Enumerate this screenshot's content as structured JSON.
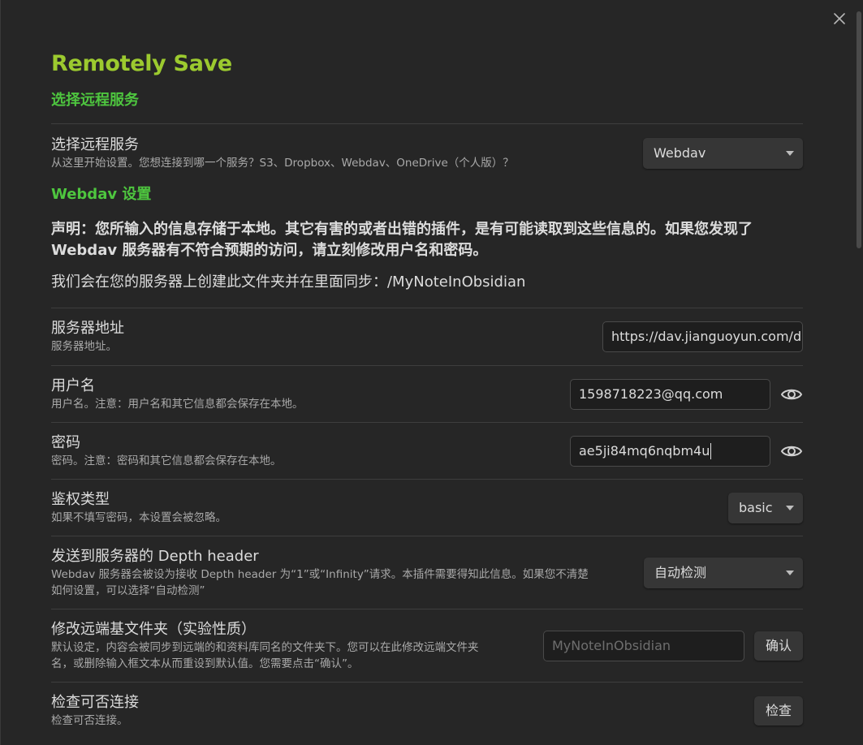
{
  "modal": {
    "title": "Remotely Save",
    "close_icon": "close-icon"
  },
  "section_remote": {
    "heading": "选择远程服务"
  },
  "choose_service": {
    "name": "选择远程服务",
    "desc": "从这里开始设置。您想连接到哪一个服务？S3、Dropbox、Webdav、OneDrive（个人版）？",
    "value": "Webdav"
  },
  "section_webdav": {
    "heading": "Webdav 设置"
  },
  "notice": {
    "line1": "声明：您所输入的信息存储于本地。其它有害的或者出错的插件，是有可能读取到这些信息的。如果您发现了",
    "line2": "Webdav 服务器有不符合预期的访问，请立刻修改用户名和密码。"
  },
  "folder_info": "我们会在您的服务器上创建此文件夹并在里面同步：/MyNoteInObsidian",
  "server_address": {
    "name": "服务器地址",
    "desc": "服务器地址。",
    "value": "https://dav.jianguoyun.com/d"
  },
  "username": {
    "name": "用户名",
    "desc": "用户名。注意：用户名和其它信息都会保存在本地。",
    "value": "1598718223@qq.com",
    "icon": "eye-icon"
  },
  "password": {
    "name": "密码",
    "desc": "密码。注意：密码和其它信息都会保存在本地。",
    "value": "ae5ji84mq6nqbm4u",
    "icon": "eye-icon"
  },
  "auth_type": {
    "name": "鉴权类型",
    "desc": "如果不填写密码，本设置会被忽略。",
    "value": "basic"
  },
  "depth_header": {
    "name": "发送到服务器的 Depth header",
    "desc_line1": "Webdav 服务器会被设为接收 Depth header 为“1”或“Infinity”请求。本插件需要得知此信息。如果您不清楚",
    "desc_line2": "如何设置，可以选择“自动检测”",
    "value": "自动检测"
  },
  "remote_base_dir": {
    "name": "修改远端基文件夹（实验性质）",
    "desc_line1": "默认设定，内容会被同步到远端的和资料库同名的文件夹下。您可以在此修改远端文件夹",
    "desc_line2": "名，或删除输入框文本从而重设到默认值。您需要点击“确认”。",
    "placeholder": "MyNoteInObsidian",
    "button": "确认"
  },
  "check_connection": {
    "name": "检查可否连接",
    "desc": "检查可否连接。",
    "button": "检查"
  },
  "colors": {
    "title": "#9cca2f",
    "section": "#4ec63f",
    "background": "#262626"
  }
}
